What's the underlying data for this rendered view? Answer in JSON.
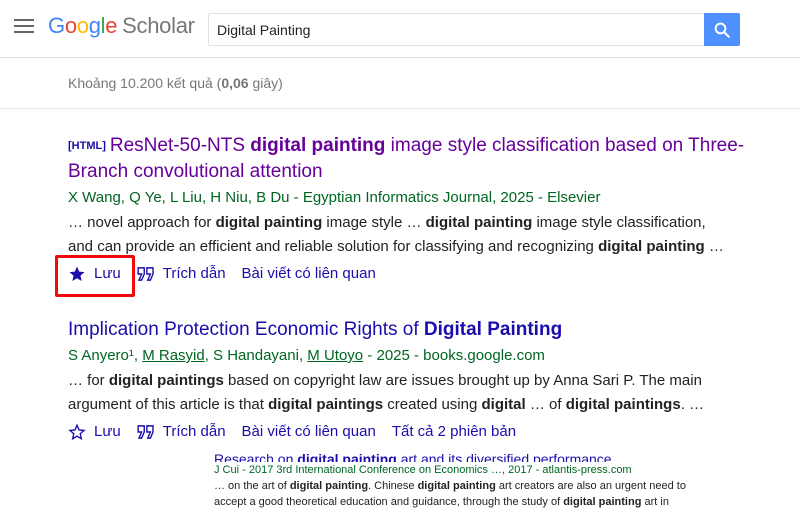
{
  "header": {
    "logo_google": [
      "G",
      "o",
      "o",
      "g",
      "l",
      "e"
    ],
    "logo_scholar": "Scholar",
    "search_value": "Digital Painting"
  },
  "stats": {
    "prefix": "Khoảng 10.200 kết quả (",
    "time": "0,06",
    "suffix": " giây)"
  },
  "results": [
    {
      "tag": "[HTML]",
      "title_a": "ResNet-50-NTS ",
      "title_b": "digital painting",
      "title_c": " image style classification based on Three-",
      "title_line2": "Branch convolutional attention",
      "authors": "X Wang, Q Ye, L Liu, H Niu, B Du - Egyptian Informatics Journal, 2025 - Elsevier",
      "snippet1": [
        "… novel approach for ",
        "digital painting",
        " image style … ",
        "digital painting",
        " image style classification,"
      ],
      "snippet2": [
        "and can provide an efficient and reliable solution for classifying and recognizing ",
        "digital painting",
        " …"
      ],
      "save_label": "Lưu",
      "cite_label": "Trích dẫn",
      "related_label": "Bài viết có liên quan"
    },
    {
      "title_a": "Implication Protection Economic Rights of ",
      "title_b": "Digital Painting",
      "authors_a": "S Anyero¹, ",
      "authors_b": "M Rasyid",
      "authors_c": ", S Handayani, ",
      "authors_d": "M Utoyo",
      "authors_e": " - 2025 - books.google.com",
      "snippet1": [
        "… for ",
        "digital paintings",
        " based on copyright law are issues brought up by Anna Sari P. The main"
      ],
      "snippet2": [
        "argument of this article is that ",
        "digital paintings",
        " created using ",
        "digital",
        " … of ",
        "digital paintings",
        ". …"
      ],
      "save_label": "Lưu",
      "cite_label": "Trích dẫn",
      "related_label": "Bài viết có liên quan",
      "versions_label": "Tất cả 2 phiên bản"
    }
  ],
  "partial": {
    "title_a": "Research on ",
    "title_b": "digital painting",
    "title_c": " art and its diversified performance",
    "authors": "J Cui - 2017 3rd International Conference on Economics …, 2017 - atlantis-press.com",
    "snippet1": [
      "… on the art of ",
      "digital painting",
      ". Chinese ",
      "digital painting",
      " art creators are also an urgent need to"
    ],
    "snippet2": [
      "accept a good theoretical education and guidance, through the study of ",
      "digital painting",
      " art in"
    ]
  },
  "colors": {
    "link": "#1a0dab",
    "visited": "#660099",
    "green": "#006621",
    "search_button": "#4d90fe",
    "highlight": "#f20a0a"
  },
  "icons": [
    "menu-icon",
    "search-icon",
    "star-filled-icon",
    "star-outline-icon",
    "quote-icon"
  ]
}
